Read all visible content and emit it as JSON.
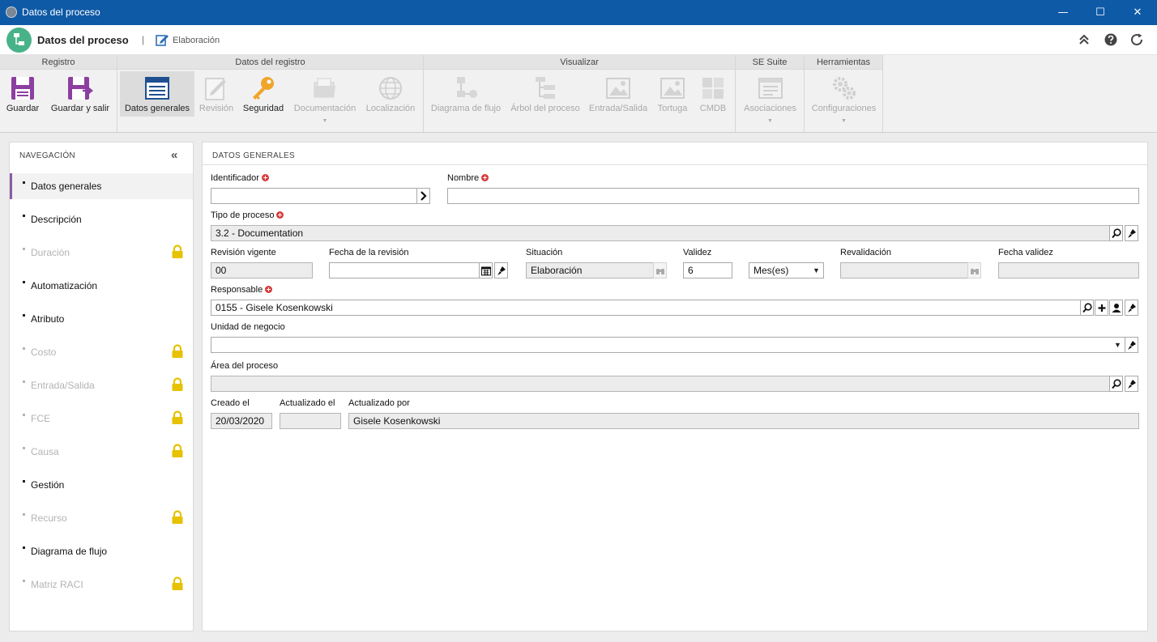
{
  "window": {
    "title": "Datos del proceso",
    "minimize": "—",
    "maximize": "☐",
    "close": "✕"
  },
  "header": {
    "title": "Datos del proceso",
    "separator": "|",
    "status": "Elaboración"
  },
  "ribbon": {
    "groups": [
      {
        "title": "Registro"
      },
      {
        "title": "Datos del registro"
      },
      {
        "title": "Visualizar"
      },
      {
        "title": "SE Suite"
      },
      {
        "title": "Herramientas"
      }
    ],
    "buttons": {
      "guardar": "Guardar",
      "guardar_salir": "Guardar y salir",
      "datos_generales": "Datos generales",
      "revision": "Revisión",
      "seguridad": "Seguridad",
      "documentacion": "Documentación",
      "localizacion": "Localización",
      "diagrama": "Diagrama de flujo",
      "arbol": "Árbol del proceso",
      "entrada_salida": "Entrada/Salida",
      "tortuga": "Tortuga",
      "cmdb": "CMDB",
      "asociaciones": "Asociaciones",
      "configuraciones": "Configuraciones"
    },
    "caret": "▼"
  },
  "nav": {
    "title": "NAVEGACIÓN",
    "collapse": "«",
    "items": [
      {
        "label": "Datos generales",
        "state": "active"
      },
      {
        "label": "Descripción",
        "state": "enabled"
      },
      {
        "label": "Duración",
        "state": "locked"
      },
      {
        "label": "Automatización",
        "state": "enabled"
      },
      {
        "label": "Atributo",
        "state": "enabled"
      },
      {
        "label": "Costo",
        "state": "locked"
      },
      {
        "label": "Entrada/Salida",
        "state": "locked"
      },
      {
        "label": "FCE",
        "state": "locked"
      },
      {
        "label": "Causa",
        "state": "locked"
      },
      {
        "label": "Gestión",
        "state": "enabled"
      },
      {
        "label": "Recurso",
        "state": "locked"
      },
      {
        "label": "Diagrama de flujo",
        "state": "enabled"
      },
      {
        "label": "Matriz RACI",
        "state": "locked"
      }
    ]
  },
  "form": {
    "section_title": "DATOS GENERALES",
    "identificador": {
      "label": "Identificador",
      "value": ""
    },
    "nombre": {
      "label": "Nombre",
      "value": ""
    },
    "tipo_proceso": {
      "label": "Tipo de proceso",
      "value": "3.2 - Documentation"
    },
    "revision_vigente": {
      "label": "Revisión vigente",
      "value": "00"
    },
    "fecha_revision": {
      "label": "Fecha de la revisión",
      "value": ""
    },
    "situacion": {
      "label": "Situación",
      "value": "Elaboración"
    },
    "validez": {
      "label": "Validez",
      "value": "6",
      "unit": "Mes(es)"
    },
    "revalidacion": {
      "label": "Revalidación",
      "value": ""
    },
    "fecha_validez": {
      "label": "Fecha validez",
      "value": ""
    },
    "responsable": {
      "label": "Responsable",
      "value": "0155 - Gisele Kosenkowski"
    },
    "unidad_negocio": {
      "label": "Unidad de negocio",
      "value": ""
    },
    "area_proceso": {
      "label": "Área del proceso",
      "value": ""
    },
    "creado_el": {
      "label": "Creado el",
      "value": "20/03/2020"
    },
    "actualizado_el": {
      "label": "Actualizado el",
      "value": ""
    },
    "actualizado_por": {
      "label": "Actualizado por",
      "value": "Gisele Kosenkowski"
    }
  },
  "colors": {
    "titlebar": "#0f5aa6",
    "accent": "#8c5aa8",
    "app_badge": "#48b389",
    "lock": "#e6c200"
  }
}
